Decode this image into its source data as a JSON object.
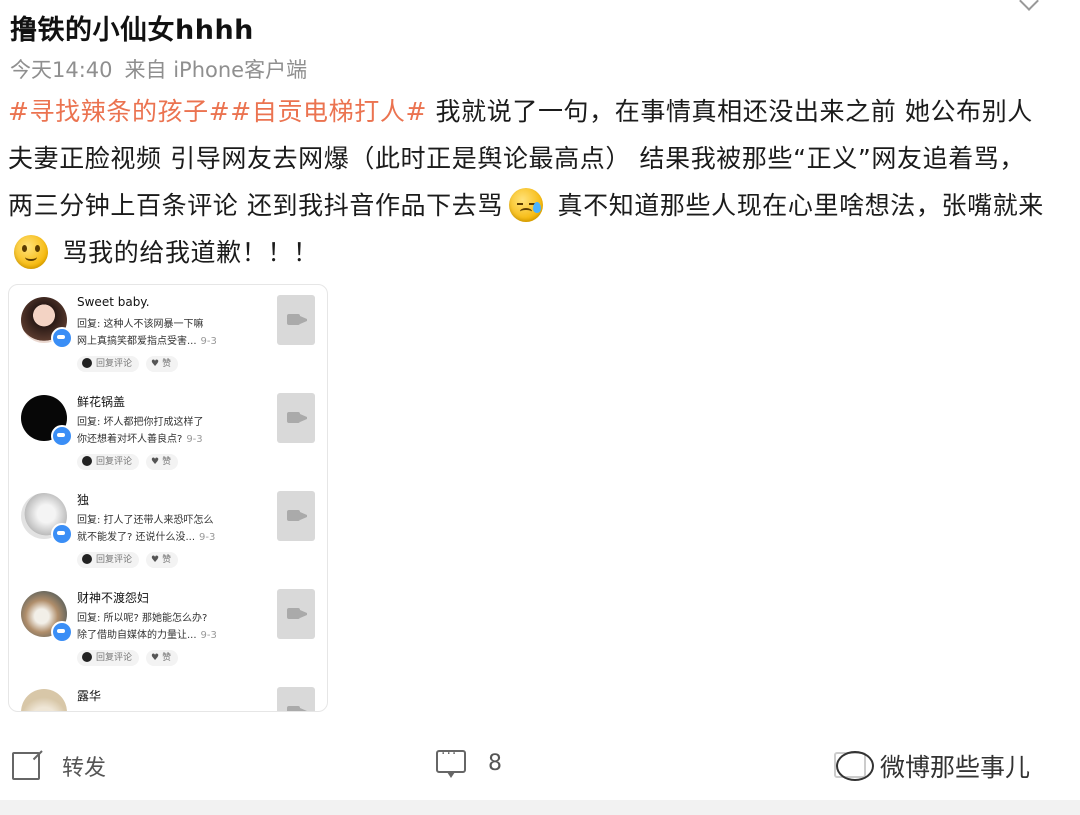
{
  "post": {
    "author": "撸铁的小仙女hhhh",
    "time": "今天14:40",
    "source": "来自 iPhone客户端",
    "tag1": "#寻找辣条的孩子#",
    "tag2": "#自贡电梯打人#",
    "text1": " 我就说了一句，在事情真相还没出来之前 她公布别人夫妻正脸视频 引导网友去网爆（此时正是舆论最高点） 结果我被那些“正义”网友追着骂，两三分钟上百条评论 还到我抖音作品下去骂",
    "text2": " 真不知道那些人现在心里啥想法，张嘴就来",
    "text3": " 骂我的给我道歉！！！"
  },
  "comments": [
    {
      "name": "Sweet baby.",
      "line1": "回复: 这种人不该网暴一下嘛",
      "line2": "网上真搞笑都爱指点受害...",
      "date": "9-3",
      "reply_label": "回复评论",
      "like_label": "赞"
    },
    {
      "name": "鲜花锅盖",
      "line1": "回复: 坏人都把你打成这样了",
      "line2": "你还想着对坏人善良点?",
      "date": "9-3",
      "reply_label": "回复评论",
      "like_label": "赞"
    },
    {
      "name": "独",
      "line1": "回复: 打人了还带人来恐吓怎么",
      "line2": "就不能发了? 还说什么没...",
      "date": "9-3",
      "reply_label": "回复评论",
      "like_label": "赞"
    },
    {
      "name": "财神不渡怨妇",
      "line1": "回复: 所以呢? 那她能怎么办?",
      "line2": "除了借助自媒体的力量让...",
      "date": "9-3",
      "reply_label": "回复评论",
      "like_label": "赞"
    },
    {
      "name": "露华"
    }
  ],
  "actions": {
    "repost_label": "转发",
    "comment_count": "8",
    "watermark": "微博那些事儿"
  },
  "icons": {
    "emoji1": "cold-sweat-emoji",
    "emoji2": "smile-emoji",
    "repost": "repost-icon",
    "comment": "comment-icon"
  },
  "colors": {
    "tag": "#eb7350",
    "meta": "#8f8f8f",
    "badge": "#3a8ef6"
  }
}
